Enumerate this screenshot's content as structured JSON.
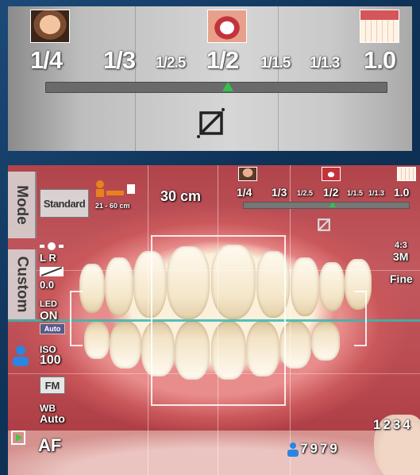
{
  "zoom_panel": {
    "ratios_big": [
      "1/4",
      "1/3",
      "1/2",
      "1.0"
    ],
    "ratios_small": [
      "1/2.5",
      "1/1.5",
      "1/1.3"
    ],
    "current_ratio": "1/2",
    "thumbnails": [
      "face-preview-thumbnail",
      "mouth-preview-thumbnail",
      "teeth-closeup-thumbnail"
    ],
    "marker_color": "#33c24a",
    "marker_position_fraction": 0.54
  },
  "camera_view": {
    "mode_tab": "Mode",
    "custom_tab": "Custom",
    "mode_value": "Standard",
    "distance_range": "21 - 60 cm",
    "distance": "30 cm",
    "mini_ratios": {
      "r1": "1/4",
      "r2": "1/3",
      "r3": "1/2.5",
      "r4": "1/2",
      "r5": "1/1.5",
      "r6": "1/1.3",
      "r7": "1.0"
    },
    "flash": {
      "lights": "L  R",
      "exposure": "0.0"
    },
    "led": {
      "label": "LED",
      "state": "ON",
      "mode": "Auto"
    },
    "iso": {
      "label": "ISO",
      "value": "100"
    },
    "fm": "FM",
    "wb": {
      "label": "WB",
      "value": "Auto"
    },
    "af": "AF",
    "aspect": "4:3",
    "size": "3M",
    "quality": "Fine",
    "shot_count": "1234",
    "patient_id": "7979",
    "guide_color": "#34b8b2"
  }
}
